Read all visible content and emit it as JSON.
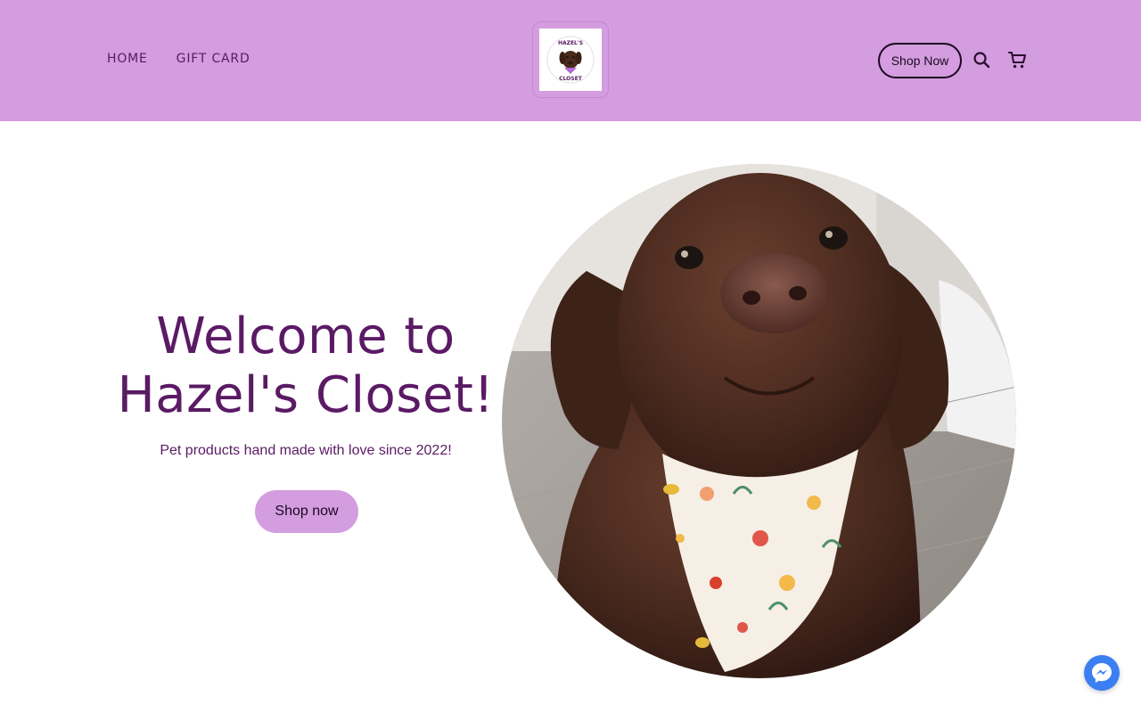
{
  "header": {
    "nav": [
      {
        "label": "HOME"
      },
      {
        "label": "GIFT CARD"
      }
    ],
    "logo": {
      "text_top": "HAZEL'S",
      "text_bottom": "CLOSET"
    },
    "shop_now_label": "Shop Now",
    "search_icon": "search-icon",
    "cart_icon": "cart-icon",
    "background": "#d39ddf"
  },
  "hero": {
    "title_line1": "Welcome to",
    "title_line2": "Hazel's Closet!",
    "subtitle": "Pet products hand made with love since 2022!",
    "cta_label": "Shop now",
    "image_icon": "dog-photo"
  },
  "chat": {
    "icon": "messenger-icon",
    "color": "#3b7ff3"
  },
  "colors": {
    "accent": "#d39ddf",
    "text": "#5a1a64",
    "dark": "#1b0820"
  }
}
